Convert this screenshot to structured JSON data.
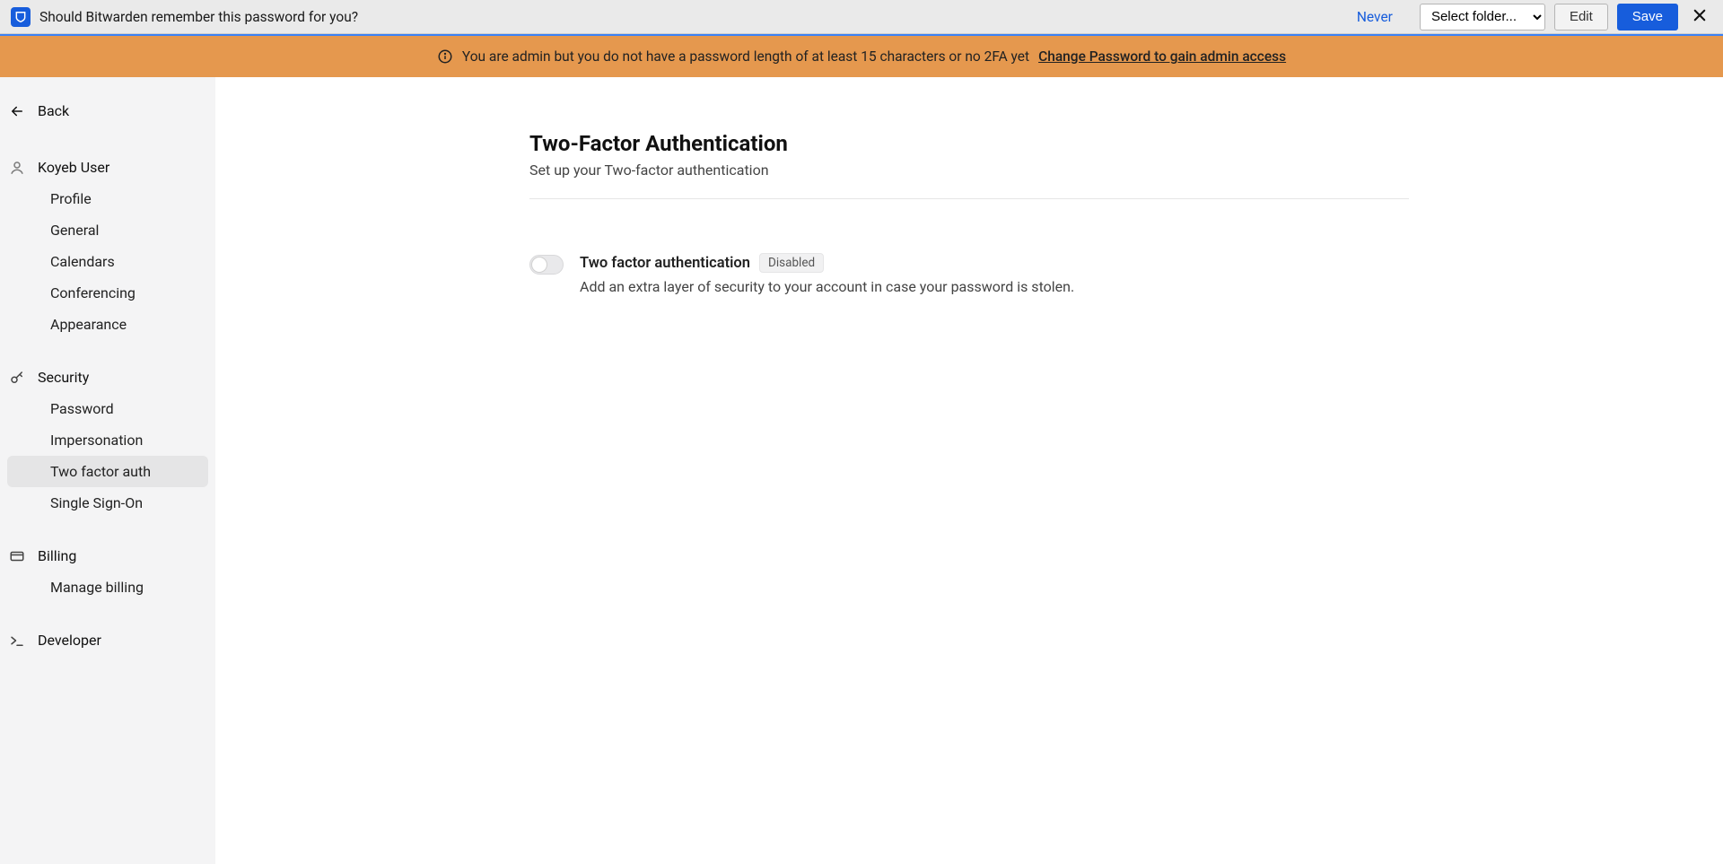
{
  "bitwarden": {
    "prompt": "Should Bitwarden remember this password for you?",
    "never": "Never",
    "folder_placeholder": "Select folder...",
    "edit": "Edit",
    "save": "Save"
  },
  "admin_banner": {
    "text": "You are admin but you do not have a password length of at least 15 characters or no 2FA yet",
    "link": "Change Password to gain admin access"
  },
  "sidebar": {
    "back": "Back",
    "user_name": "Koyeb User",
    "groups": [
      {
        "head": "Koyeb User",
        "icon": "user-icon",
        "items": [
          {
            "label": "Profile",
            "active": false
          },
          {
            "label": "General",
            "active": false
          },
          {
            "label": "Calendars",
            "active": false
          },
          {
            "label": "Conferencing",
            "active": false
          },
          {
            "label": "Appearance",
            "active": false
          }
        ]
      },
      {
        "head": "Security",
        "icon": "key-icon",
        "items": [
          {
            "label": "Password",
            "active": false
          },
          {
            "label": "Impersonation",
            "active": false
          },
          {
            "label": "Two factor auth",
            "active": true
          },
          {
            "label": "Single Sign-On",
            "active": false
          }
        ]
      },
      {
        "head": "Billing",
        "icon": "card-icon",
        "items": [
          {
            "label": "Manage billing",
            "active": false
          }
        ]
      },
      {
        "head": "Developer",
        "icon": "terminal-icon",
        "items": []
      }
    ]
  },
  "page": {
    "title": "Two-Factor Authentication",
    "subtitle": "Set up your Two-factor authentication"
  },
  "setting": {
    "title": "Two factor authentication",
    "badge": "Disabled",
    "description": "Add an extra layer of security to your account in case your password is stolen.",
    "enabled": false
  }
}
